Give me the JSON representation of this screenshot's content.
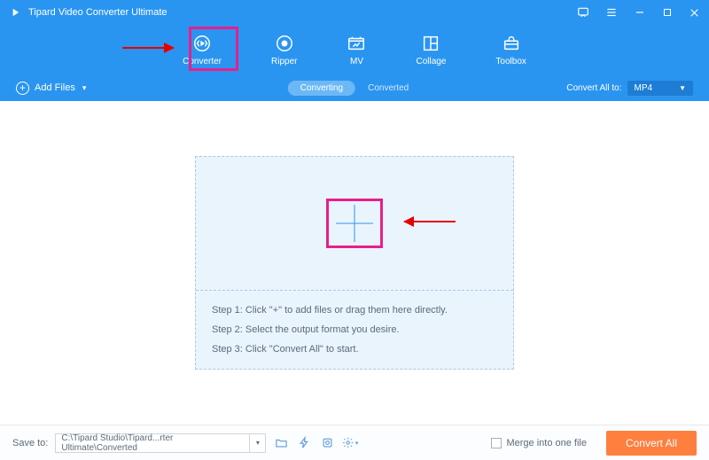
{
  "titlebar": {
    "title": "Tipard Video Converter Ultimate"
  },
  "nav": {
    "items": [
      {
        "label": "Converter"
      },
      {
        "label": "Ripper"
      },
      {
        "label": "MV"
      },
      {
        "label": "Collage"
      },
      {
        "label": "Toolbox"
      }
    ]
  },
  "toolbar": {
    "add_files": "Add Files",
    "tab_converting": "Converting",
    "tab_converted": "Converted",
    "convert_all_to": "Convert All to:",
    "format": "MP4"
  },
  "dropzone": {
    "step1": "Step 1: Click \"+\" to add files or drag them here directly.",
    "step2": "Step 2: Select the output format you desire.",
    "step3": "Step 3: Click \"Convert All\" to start."
  },
  "bottom": {
    "save_to": "Save to:",
    "path": "C:\\Tipard Studio\\Tipard...rter Ultimate\\Converted",
    "merge": "Merge into one file",
    "convert_all": "Convert All"
  }
}
